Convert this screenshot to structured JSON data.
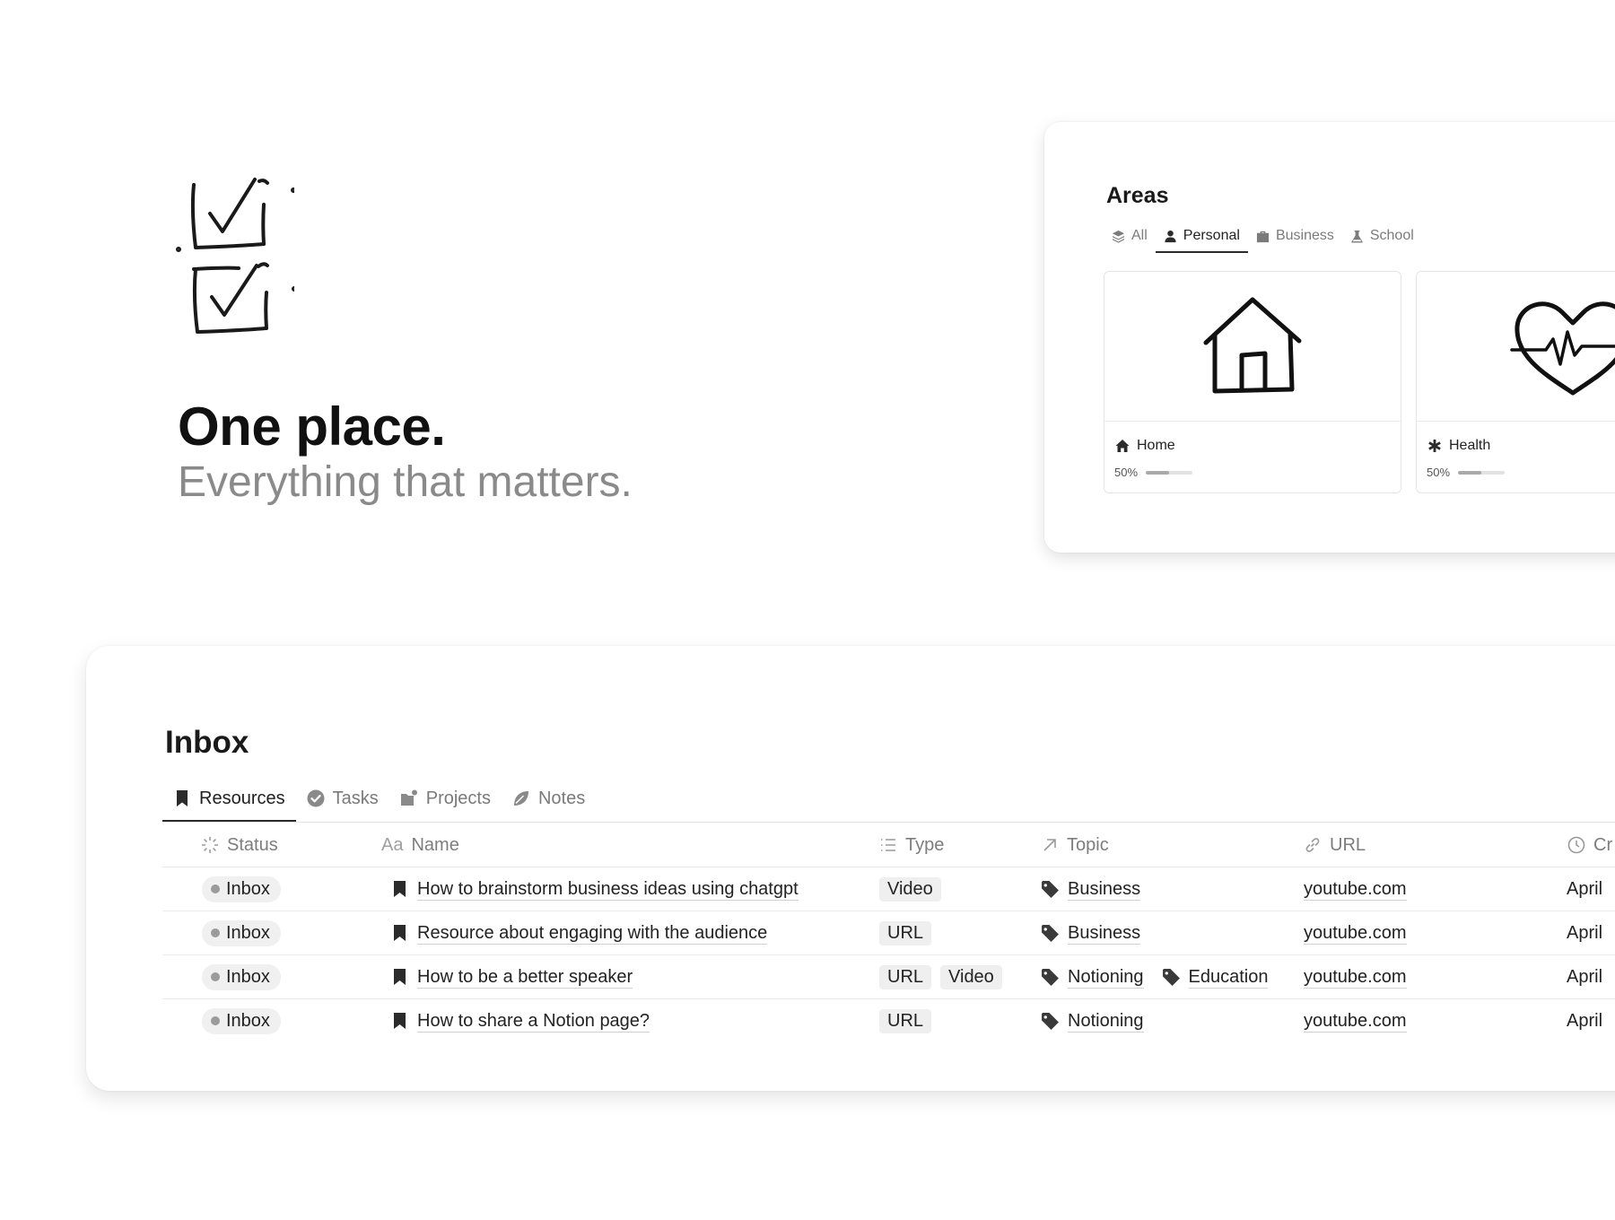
{
  "hero": {
    "title": "One place.",
    "subtitle": "Everything that matters."
  },
  "areas": {
    "title": "Areas",
    "tabs": [
      {
        "label": "All",
        "icon": "layers-icon",
        "active": false
      },
      {
        "label": "Personal",
        "icon": "person-icon",
        "active": true
      },
      {
        "label": "Business",
        "icon": "briefcase-icon",
        "active": false
      },
      {
        "label": "School",
        "icon": "flask-icon",
        "active": false
      }
    ],
    "cards": [
      {
        "name": "Home",
        "icon": "house-icon",
        "progress_label": "50%",
        "progress": 0.5
      },
      {
        "name": "Health",
        "icon": "asterisk-icon",
        "progress_label": "50%",
        "progress": 0.5
      }
    ]
  },
  "inbox": {
    "title": "Inbox",
    "tabs": [
      {
        "label": "Resources",
        "icon": "bookmark-icon",
        "active": true
      },
      {
        "label": "Tasks",
        "icon": "check-circle-icon",
        "active": false
      },
      {
        "label": "Projects",
        "icon": "folder-icon",
        "active": false
      },
      {
        "label": "Notes",
        "icon": "leaf-icon",
        "active": false
      }
    ],
    "columns": {
      "status": "Status",
      "name_prefix": "Aa",
      "name": "Name",
      "type": "Type",
      "topic": "Topic",
      "url": "URL",
      "created": "Cr"
    },
    "rows": [
      {
        "status": "Inbox",
        "name": "How to brainstorm business ideas using chatgpt",
        "types": [
          "Video"
        ],
        "topics": [
          "Business"
        ],
        "url": "youtube.com",
        "created": "April"
      },
      {
        "status": "Inbox",
        "name": "Resource about engaging with the audience",
        "types": [
          "URL"
        ],
        "topics": [
          "Business"
        ],
        "url": "youtube.com",
        "created": "April"
      },
      {
        "status": "Inbox",
        "name": "How to be a better speaker",
        "types": [
          "URL",
          "Video"
        ],
        "topics": [
          "Notioning",
          "Education"
        ],
        "url": "youtube.com",
        "created": "April"
      },
      {
        "status": "Inbox",
        "name": "How to share a Notion page?",
        "types": [
          "URL"
        ],
        "topics": [
          "Notioning"
        ],
        "url": "youtube.com",
        "created": "April"
      }
    ]
  }
}
